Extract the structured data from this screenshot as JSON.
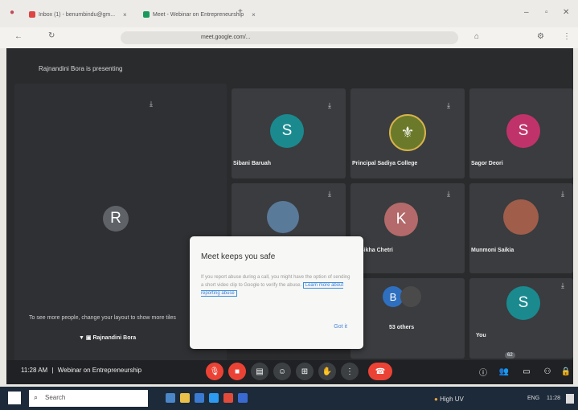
{
  "browser": {
    "tabs": [
      {
        "label": "Inbox (1) - benumbindu@gm..."
      },
      {
        "label": "Meet - Webinar on Entrepreneurship"
      }
    ],
    "url": "meet.google.com/..."
  },
  "meet": {
    "presenting_banner": "Rajnandini Bora is presenting",
    "participants": [
      {
        "initial": "S",
        "name": "Sibani Baruah",
        "color": "#1a8a8f"
      },
      {
        "initial": "",
        "name": "Principal Sadiya College",
        "color": "#6a7a2a"
      },
      {
        "initial": "S",
        "name": "Sagor Deori",
        "color": "#c0336a"
      },
      {
        "initial": "R",
        "name": "",
        "color": "#5f6368"
      },
      {
        "initial": "K",
        "name": "Sikha Chetri",
        "color": "#b46a6a"
      },
      {
        "initial": "",
        "name": "Munmoni Saikia",
        "color": "#a05d4a"
      },
      {
        "initial": "B",
        "name": "53 others",
        "color": "#2f6fc0"
      },
      {
        "initial": "S",
        "name": "You",
        "color": "#1a8a8f"
      }
    ],
    "layout_hint": "To see more people, change your layout to show more tiles",
    "presenter_name": "Rajnandini Bora",
    "time": "11:28 AM",
    "meeting_title": "Webinar on Entrepreneurship",
    "participant_count": "62"
  },
  "dialog": {
    "title": "Meet keeps you safe",
    "body": "If you report abuse during a call, you might have the option of sending a short video clip to Google to verify the abuse.",
    "link": "Learn more about reporting abuse",
    "action": "Got it"
  },
  "taskbar": {
    "search_placeholder": "Search",
    "weather": "High UV",
    "lang": "ENG",
    "clock": "11:28"
  },
  "colors": {
    "end_call": "#ea4335",
    "link": "#3b7dd8"
  }
}
